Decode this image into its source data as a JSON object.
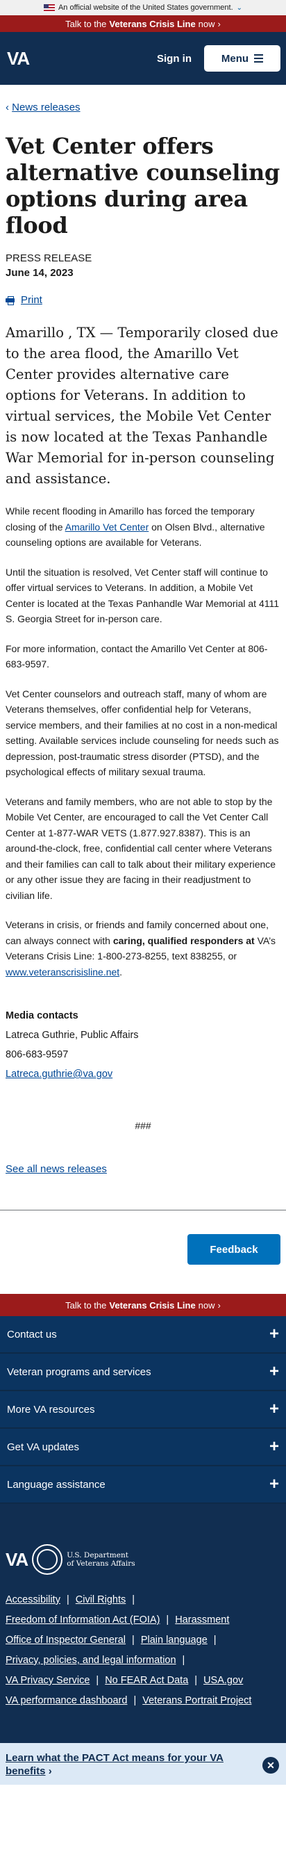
{
  "gov_banner": {
    "text": "An official website of the United States government.",
    "chevron": "⌄"
  },
  "crisis": {
    "prefix": "Talk to the ",
    "strong": "Veterans Crisis Line",
    "suffix": " now",
    "chevron": "›"
  },
  "header": {
    "logo": "VA",
    "signin": "Sign in",
    "menu": "Menu"
  },
  "breadcrumb": {
    "chevron": "‹",
    "label": "News releases"
  },
  "article": {
    "title": "Vet Center offers alternative counseling options during area flood",
    "press_label": "PRESS RELEASE",
    "date": "June 14, 2023",
    "print_label": "Print",
    "lead": "Amarillo , TX — Temporarily closed due to the area flood, the Amarillo Vet Center provides alternative care options for Veterans. In addition to virtual services, the Mobile Vet Center is now located at the Texas Panhandle War Memorial for in-person counseling and assistance.",
    "p1_before": "While recent flooding in Amarillo has forced the temporary closing of the ",
    "p1_link": "Amarillo Vet Center",
    "p1_after": " on Olsen Blvd., alternative counseling options are available for Veterans.",
    "p2": "Until the situation is resolved, Vet Center staff will continue to offer virtual services to Veterans. In addition, a Mobile Vet Center is located at the Texas Panhandle War Memorial at 4111 S. Georgia Street for in-person care.",
    "p3": "For more information, contact the Amarillo Vet Center at 806-683-9597.",
    "p4": "Vet Center counselors and outreach staff, many of whom are Veterans themselves, offer confidential help for Veterans, service members, and their families at no cost in a non-medical setting. Available services include counseling for needs such as depression, post-traumatic stress disorder (PTSD), and the psychological effects of military sexual trauma.",
    "p5": "Veterans and family members, who are not able to stop by the Mobile Vet Center, are encouraged to call the Vet Center Call Center at 1-877-WAR VETS (1.877.927.8387). This is an around-the-clock, free, confidential call center where Veterans and their families can call to talk about their military experience or any other issue they are facing in their readjustment to civilian life.",
    "p6_before": "Veterans in crisis, or friends and family concerned about one, can always connect with ",
    "p6_bold": "caring, qualified responders at",
    "p6_middle": " VA’s Veterans Crisis Line: 1-800-273-8255, text 838255, or ",
    "p6_link": "www.veteranscrisisline.net",
    "p6_after": ".",
    "contacts_heading": "Media contacts",
    "contact_name": "Latreca Guthrie, Public Affairs",
    "contact_phone": "806-683-9597",
    "contact_email": "Latreca.guthrie@va.gov",
    "end_mark": "###",
    "all_news": "See all news releases"
  },
  "feedback": "Feedback",
  "footer_nav": [
    {
      "label": "Contact us"
    },
    {
      "label": "Veteran programs and services"
    },
    {
      "label": "More VA resources"
    },
    {
      "label": "Get VA updates"
    },
    {
      "label": "Language assistance"
    }
  ],
  "footer": {
    "logo": "VA",
    "dept_line1": "U.S. Department",
    "dept_line2": "of Veterans Affairs",
    "links": {
      "accessibility": "Accessibility",
      "civil_rights": "Civil Rights",
      "foia": "Freedom of Information Act (FOIA)",
      "harassment": "Harassment",
      "oig": "Office of Inspector General",
      "plain_language": "Plain language",
      "privacy": "Privacy, policies, and legal information",
      "privacy_service": "VA Privacy Service",
      "no_fear": "No FEAR Act Data",
      "usa_gov": "USA.gov",
      "performance": "VA performance dashboard",
      "portrait": "Veterans Portrait Project"
    }
  },
  "pact_banner": {
    "text": "Learn what the PACT Act means for your VA benefits",
    "chevron": "›",
    "close": "✕"
  },
  "colors": {
    "navy": "#112e51",
    "crisis_red": "#9b1b1b",
    "link_blue": "#004795",
    "feedback_blue": "#0071bb"
  }
}
